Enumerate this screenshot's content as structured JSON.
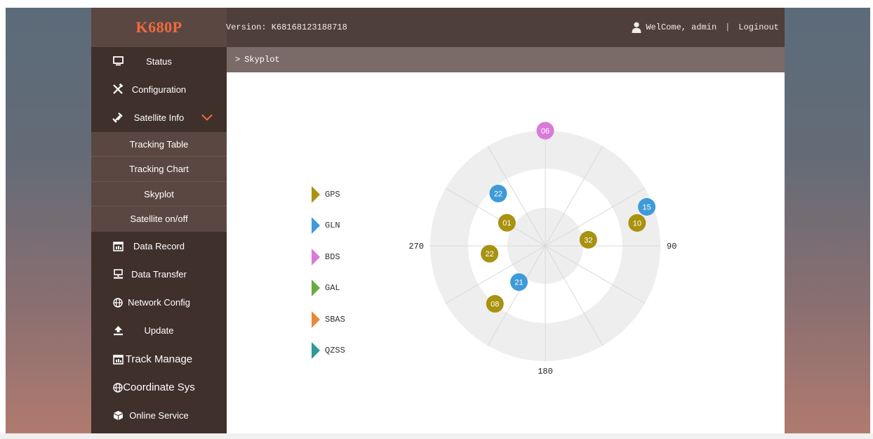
{
  "header": {
    "logo": "K680P",
    "version": "Version: K68168123188718",
    "welcome": "WelCome, admin",
    "separator": "|",
    "logout": "Loginout"
  },
  "sidebar": {
    "items": [
      {
        "label": "Status",
        "icon": "monitor-icon"
      },
      {
        "label": "Configuration",
        "icon": "tools-icon"
      },
      {
        "label": "Satellite Info",
        "icon": "satellite-icon",
        "expanded": true
      }
    ],
    "submenu": [
      "Tracking Table",
      "Tracking Chart",
      "Skyplot",
      "Satellite on/off"
    ],
    "items_after": [
      {
        "label": "Data Record",
        "icon": "calendar-icon"
      },
      {
        "label": "Data Transfer",
        "icon": "transfer-icon"
      },
      {
        "label": "Network Config",
        "icon": "globe-icon"
      },
      {
        "label": "Update",
        "icon": "upload-icon"
      },
      {
        "label": "Track Manage",
        "icon": "calendar-icon"
      },
      {
        "label": "Coordinate Sys",
        "icon": "globe-icon"
      },
      {
        "label": "Online Service",
        "icon": "cube-icon"
      }
    ]
  },
  "breadcrumb": {
    "arrow": ">",
    "label": "Skyplot"
  },
  "legend": [
    {
      "label": "GPS",
      "color": "#a8920f"
    },
    {
      "label": "GLN",
      "color": "#3f9ad9"
    },
    {
      "label": "BDS",
      "color": "#d97ad8"
    },
    {
      "label": "GAL",
      "color": "#6aaa3e"
    },
    {
      "label": "SBAS",
      "color": "#e58a3a"
    },
    {
      "label": "QZSS",
      "color": "#2f9a97"
    }
  ],
  "skyplot": {
    "azimuth_labels": {
      "north": "",
      "east": "90",
      "south": "180",
      "west": "270"
    },
    "satellites": [
      {
        "prn": "06",
        "system": "BDS",
        "azimuth": 0,
        "elevation": 0
      },
      {
        "prn": "22",
        "system": "GLN",
        "azimuth": 318,
        "elevation": 35
      },
      {
        "prn": "01",
        "system": "GPS",
        "azimuth": 301,
        "elevation": 55
      },
      {
        "prn": "15",
        "system": "GLN",
        "azimuth": 69,
        "elevation": 5
      },
      {
        "prn": "10",
        "system": "GPS",
        "azimuth": 76,
        "elevation": 16
      },
      {
        "prn": "32",
        "system": "GPS",
        "azimuth": 82,
        "elevation": 56
      },
      {
        "prn": "22",
        "system": "GPS",
        "azimuth": 262,
        "elevation": 46
      },
      {
        "prn": "21",
        "system": "GLN",
        "azimuth": 216,
        "elevation": 55
      },
      {
        "prn": "08",
        "system": "GPS",
        "azimuth": 221,
        "elevation": 30
      }
    ],
    "system_colors": {
      "GPS": "#a8920f",
      "GLN": "#3f9ad9",
      "BDS": "#d97ad8",
      "GAL": "#6aaa3e",
      "SBAS": "#e58a3a",
      "QZSS": "#2f9a97"
    }
  }
}
